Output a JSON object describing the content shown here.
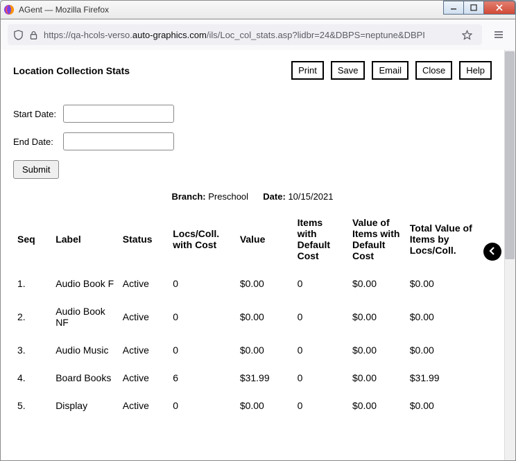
{
  "window": {
    "title": "AGent — Mozilla Firefox"
  },
  "url": {
    "prefix": "https://qa-hcols-verso.",
    "domain": "auto-graphics.com",
    "suffix": "/ils/Loc_col_stats.asp?lidbr=24&DBPS=neptune&DBPI"
  },
  "page": {
    "title": "Location Collection Stats"
  },
  "actions": {
    "print": "Print",
    "save": "Save",
    "email": "Email",
    "close": "Close",
    "help": "Help"
  },
  "form": {
    "start_date_label": "Start Date:",
    "start_date_value": "",
    "end_date_label": "End Date:",
    "end_date_value": "",
    "submit": "Submit"
  },
  "meta": {
    "branch_label": "Branch:",
    "branch_value": "Preschool",
    "date_label": "Date:",
    "date_value": "10/15/2021"
  },
  "table": {
    "headers": {
      "seq": "Seq",
      "label": "Label",
      "status": "Status",
      "locs_cost": "Locs/Coll. with Cost",
      "value": "Value",
      "items_default": "Items with Default Cost",
      "value_default": "Value of Items with Default Cost",
      "total_value": "Total Value of Items by Locs/Coll."
    },
    "rows": [
      {
        "seq": "1.",
        "label": "Audio Book F",
        "status": "Active",
        "locs_cost": "0",
        "value": "$0.00",
        "items_default": "0",
        "value_default": "$0.00",
        "total_value": "$0.00"
      },
      {
        "seq": "2.",
        "label": "Audio Book NF",
        "status": "Active",
        "locs_cost": "0",
        "value": "$0.00",
        "items_default": "0",
        "value_default": "$0.00",
        "total_value": "$0.00"
      },
      {
        "seq": "3.",
        "label": "Audio Music",
        "status": "Active",
        "locs_cost": "0",
        "value": "$0.00",
        "items_default": "0",
        "value_default": "$0.00",
        "total_value": "$0.00"
      },
      {
        "seq": "4.",
        "label": "Board Books",
        "status": "Active",
        "locs_cost": "6",
        "value": "$31.99",
        "items_default": "0",
        "value_default": "$0.00",
        "total_value": "$31.99"
      },
      {
        "seq": "5.",
        "label": "Display",
        "status": "Active",
        "locs_cost": "0",
        "value": "$0.00",
        "items_default": "0",
        "value_default": "$0.00",
        "total_value": "$0.00"
      }
    ]
  }
}
